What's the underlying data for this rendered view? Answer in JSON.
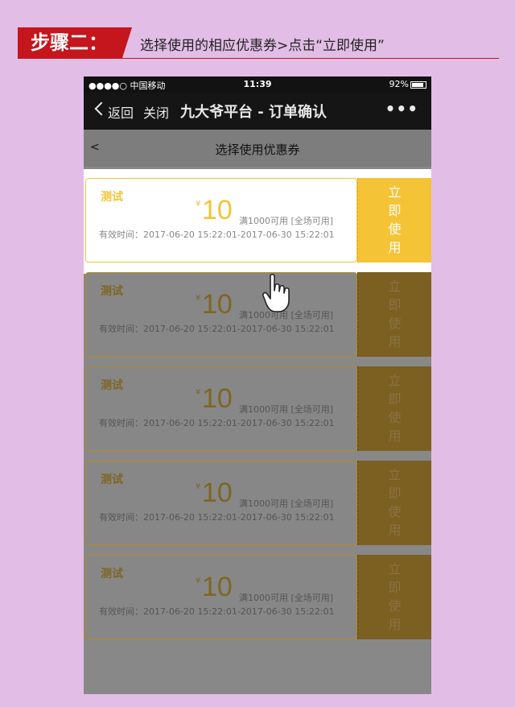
{
  "step": {
    "badge": "步骤二：",
    "instruction": "选择使用的相应优惠券>点击“立即使用”",
    "colors": {
      "badge": "#c4161c",
      "background": "#e2bde6"
    }
  },
  "status_bar": {
    "signal": "●●●●○ 中国移动",
    "wifi": "wifi-icon",
    "time": "11:39",
    "right": "92%"
  },
  "nav": {
    "back_label": "返回",
    "close_label": "关闭",
    "title": "九大爷平台 - 订单确认",
    "more": "•••"
  },
  "page": {
    "back": "<",
    "title": "选择使用优惠券"
  },
  "coupons": [
    {
      "name": "测试",
      "currency": "¥",
      "amount": "10",
      "condition": "满1000可用 [全场可用]",
      "validity": "有效时间：2017-06-20 15:22:01-2017-06-30 15:22:01",
      "button": [
        "立",
        "即",
        "使",
        "用"
      ]
    },
    {
      "name": "测试",
      "currency": "¥",
      "amount": "10",
      "condition": "满1000可用 [全场可用]",
      "validity": "有效时间：2017-06-20 15:22:01-2017-06-30 15:22:01",
      "button": [
        "立",
        "即",
        "使",
        "用"
      ]
    },
    {
      "name": "测试",
      "currency": "¥",
      "amount": "10",
      "condition": "满1000可用 [全场可用]",
      "validity": "有效时间：2017-06-20 15:22:01-2017-06-30 15:22:01",
      "button": [
        "立",
        "即",
        "使",
        "用"
      ]
    },
    {
      "name": "测试",
      "currency": "¥",
      "amount": "10",
      "condition": "满1000可用 [全场可用]",
      "validity": "有效时间：2017-06-20 15:22:01-2017-06-30 15:22:01",
      "button": [
        "立",
        "即",
        "使",
        "用"
      ]
    },
    {
      "name": "测试",
      "currency": "¥",
      "amount": "10",
      "condition": "满1000可用 [全场可用]",
      "validity": "有效时间：2017-06-20 15:22:01-2017-06-30 15:22:01",
      "button": [
        "立",
        "即",
        "使",
        "用"
      ]
    }
  ],
  "accent_color": "#f5c336"
}
